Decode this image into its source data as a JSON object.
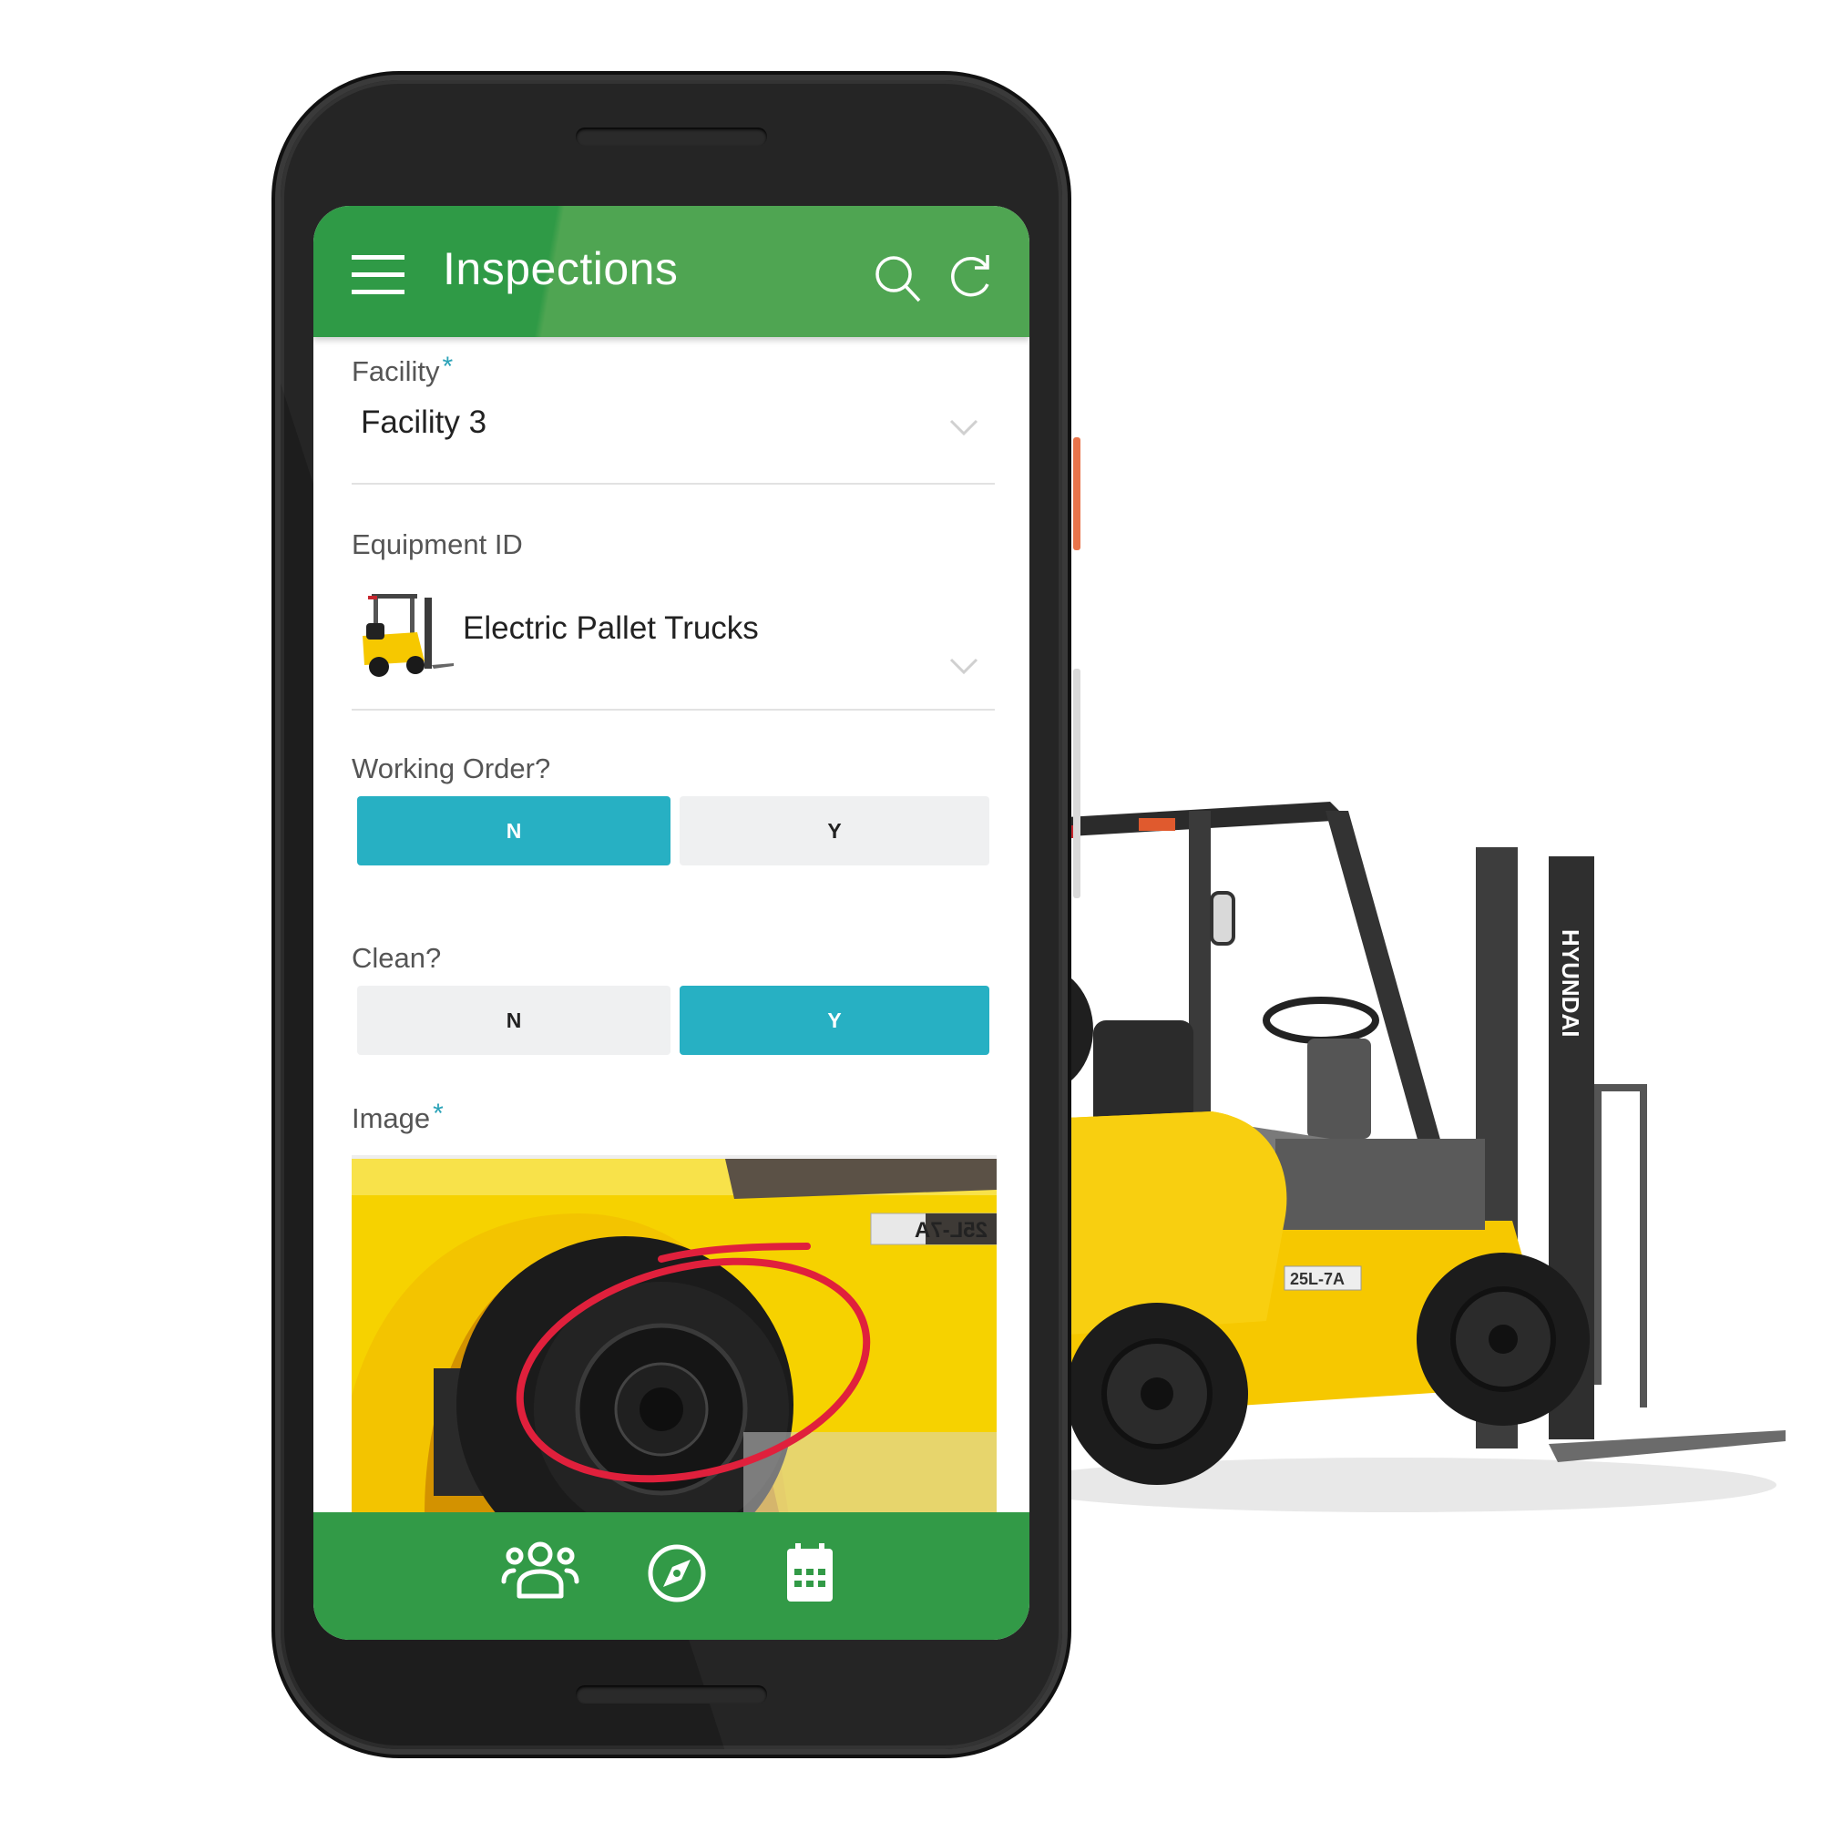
{
  "app": {
    "title": "Inspections",
    "header_icons": [
      "menu-icon",
      "search-icon",
      "refresh-icon"
    ],
    "accent_color": "#329a47",
    "toggle_active_color": "#27b0c3"
  },
  "form": {
    "facility": {
      "label": "Facility",
      "required_mark": "*",
      "value": "Facility 3"
    },
    "equipment": {
      "label": "Equipment ID",
      "value": "Electric Pallet Trucks",
      "thumbnail_icon": "forklift-thumbnail"
    },
    "working_order": {
      "label": "Working Order?",
      "options": [
        "N",
        "Y"
      ],
      "selected": "N"
    },
    "clean": {
      "label": "Clean?",
      "options": [
        "N",
        "Y"
      ],
      "selected": "Y"
    },
    "image": {
      "label": "Image",
      "required_mark": "*",
      "content": "forklift-tire-photo-with-red-circle-annotation",
      "decal_text": "25L-7A"
    }
  },
  "bottom_nav": {
    "items": [
      {
        "icon": "people-icon"
      },
      {
        "icon": "compass-icon"
      },
      {
        "icon": "calendar-icon"
      }
    ]
  },
  "background": {
    "illustration": "yellow-forklift",
    "mast_brand": "HYUNDAI",
    "decal_text": "25L-7A"
  }
}
